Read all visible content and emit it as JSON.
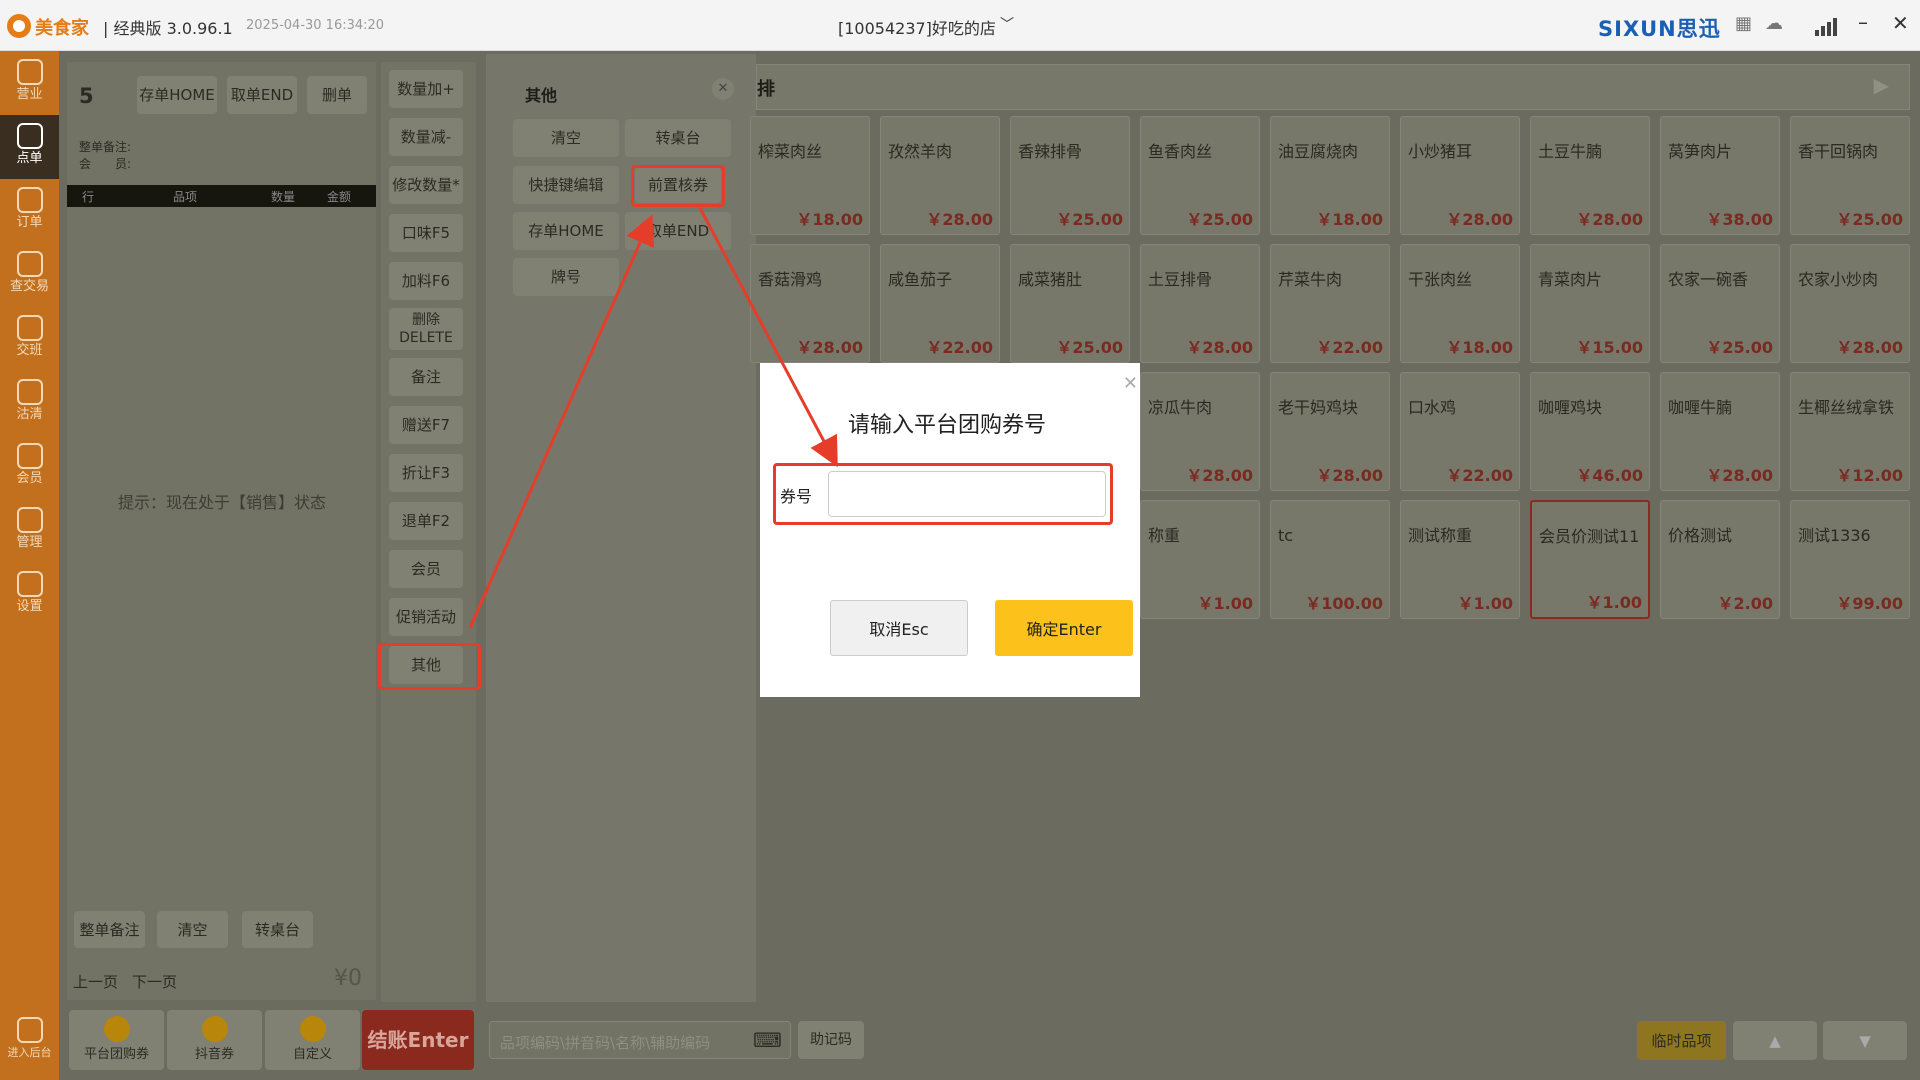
{
  "titlebar": {
    "app_name": "美食家",
    "version": "| 经典版 3.0.96.1",
    "datetime": "2025-04-30 16:34:20",
    "store": "[10054237]好吃的店",
    "brand": "SIXUN思迅"
  },
  "sidebar": {
    "items": [
      {
        "label": "营业",
        "icon": "chart-icon"
      },
      {
        "label": "点单",
        "icon": "hand-tap-icon"
      },
      {
        "label": "订单",
        "icon": "document-icon"
      },
      {
        "label": "查交易",
        "icon": "bag-icon"
      },
      {
        "label": "交班",
        "icon": "swap-icon"
      },
      {
        "label": "沽清",
        "icon": "dish-icon"
      },
      {
        "label": "会员",
        "icon": "person-icon"
      },
      {
        "label": "管理",
        "icon": "manage-icon"
      },
      {
        "label": "设置",
        "icon": "gear-icon"
      }
    ],
    "bottom_label": "进入后台"
  },
  "order": {
    "count": "5",
    "save_btn": "存单HOME",
    "fetch_btn": "取单END",
    "delete_btn": "删单",
    "note_label": "整单备注:",
    "member_label": "会　　员:",
    "columns": [
      "行",
      "品项",
      "数量",
      "金额"
    ],
    "hint": "提示：现在处于【销售】状态",
    "note_btn": "整单备注",
    "clear_btn": "清空",
    "transfer_btn": "转桌台",
    "prev_page": "上一页",
    "next_page": "下一页",
    "total": "¥0"
  },
  "payments": [
    {
      "label": "平台团购券"
    },
    {
      "label": "抖音券"
    },
    {
      "label": "自定义"
    }
  ],
  "checkout": "结账Enter",
  "func_buttons": [
    "数量加+",
    "数量减-",
    "修改数量*",
    "口味F5",
    "加料F6",
    "删除\nDELETE",
    "备注",
    "赠送F7",
    "折让F3",
    "退单F2",
    "会员",
    "促销活动",
    "其他"
  ],
  "other_panel": {
    "title": "其他",
    "buttons": [
      "清空",
      "转桌台",
      "快捷键编辑",
      "前置核券",
      "存单HOME",
      "取单END",
      "牌号"
    ]
  },
  "category": {
    "label": "排"
  },
  "dishes": [
    {
      "name": "榨菜肉丝",
      "price": "￥18.00"
    },
    {
      "name": "孜然羊肉",
      "price": "￥28.00"
    },
    {
      "name": "香辣排骨",
      "price": "￥25.00"
    },
    {
      "name": "鱼香肉丝",
      "price": "￥25.00"
    },
    {
      "name": "油豆腐烧肉",
      "price": "￥18.00"
    },
    {
      "name": "小炒猪耳",
      "price": "￥28.00"
    },
    {
      "name": "土豆牛腩",
      "price": "￥28.00"
    },
    {
      "name": "莴笋肉片",
      "price": "￥38.00"
    },
    {
      "name": "香干回锅肉",
      "price": "￥25.00"
    },
    {
      "name": "香菇滑鸡",
      "price": "￥28.00"
    },
    {
      "name": "咸鱼茄子",
      "price": "￥22.00"
    },
    {
      "name": "咸菜猪肚",
      "price": "￥25.00"
    },
    {
      "name": "土豆排骨",
      "price": "￥28.00"
    },
    {
      "name": "芹菜牛肉",
      "price": "￥22.00"
    },
    {
      "name": "干张肉丝",
      "price": "￥18.00"
    },
    {
      "name": "青菜肉片",
      "price": "￥15.00"
    },
    {
      "name": "农家一碗香",
      "price": "￥25.00"
    },
    {
      "name": "农家小炒肉",
      "price": "￥28.00"
    },
    {
      "name": "凉瓜牛肉",
      "price": "￥28.00"
    },
    {
      "name": "老干妈鸡块",
      "price": "￥28.00"
    },
    {
      "name": "口水鸡",
      "price": "￥22.00"
    },
    {
      "name": "咖喱鸡块",
      "price": "￥46.00"
    },
    {
      "name": "咖喱牛腩",
      "price": "￥28.00"
    },
    {
      "name": "生椰丝绒拿铁",
      "price": "￥12.00"
    },
    {
      "name": "称重",
      "price": "￥1.00"
    },
    {
      "name": "tc",
      "price": "￥100.00"
    },
    {
      "name": "测试称重",
      "price": "￥1.00"
    },
    {
      "name": "会员价测试11",
      "price": "￥1.00"
    },
    {
      "name": "价格测试",
      "price": "￥2.00"
    },
    {
      "name": "测试1336",
      "price": "￥99.00"
    }
  ],
  "search": {
    "placeholder": "品项编码\\拼音码\\名称\\辅助编码",
    "memo_btn": "助记码"
  },
  "temp_item_btn": "临时品项",
  "dialog": {
    "title": "请输入平台团购券号",
    "field_label": "券号",
    "cancel": "取消Esc",
    "confirm": "确定Enter"
  },
  "colors": {
    "accent": "#c2701e",
    "highlight": "#e53d2a",
    "confirm": "#fcc21b",
    "checkout": "#c0392b"
  }
}
